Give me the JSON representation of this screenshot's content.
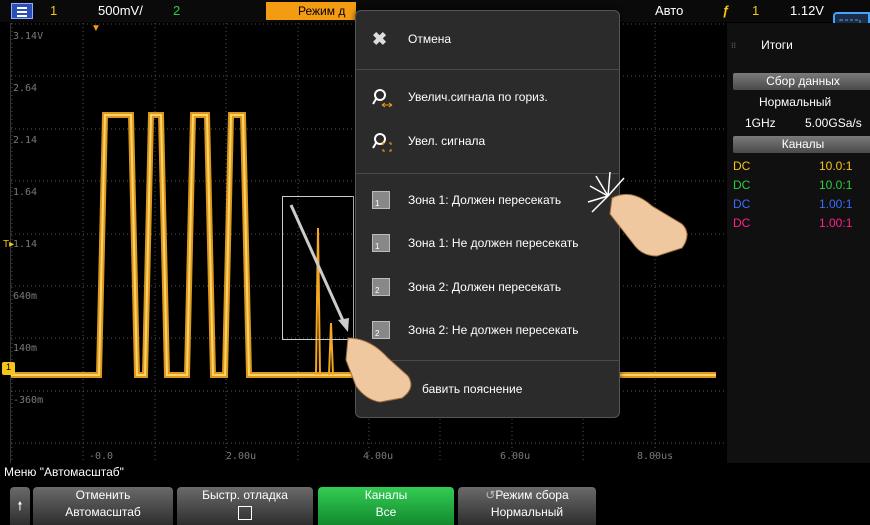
{
  "topbar": {
    "channel1": "1",
    "scale": "500mV/",
    "channel2": "2",
    "mode_tab": "Режим д",
    "trigger_mode": "Авто",
    "trigger_channel": "1",
    "trigger_level": "1.12V"
  },
  "screen": {
    "y_labels": [
      "3.14V",
      "2.64",
      "2.14",
      "1.64",
      "1.14",
      "640m",
      "140m",
      "-360m"
    ],
    "x_labels": [
      "-0.0",
      "2.00u",
      "4.00u",
      "6.00u",
      "8.00us"
    ],
    "marker_1": "1"
  },
  "popup": {
    "cancel": "Отмена",
    "zoom_horiz": "Увелич.сигнала по гориз.",
    "zoom": "Увел. сигнала",
    "zone1_must": "Зона 1: Должен пересекать",
    "zone1_must_not": "Зона 1: Не должен пересекать",
    "zone2_must": "Зона 2: Должен пересекать",
    "zone2_must_not": "Зона 2: Не должен пересекать",
    "annotate": "бавить пояснение",
    "zone1_num": "1",
    "zone2_num": "2"
  },
  "right_panel": {
    "title": "Итоги",
    "acq_header": "Сбор данных",
    "acq_mode": "Нормальный",
    "bandwidth": "1GHz",
    "sample_rate": "5.00GSa/s",
    "channels_header": "Каналы",
    "channels": [
      {
        "coupling": "DC",
        "probe": "10.0:1",
        "color": "#f5c518"
      },
      {
        "coupling": "DC",
        "probe": "10.0:1",
        "color": "#2ecc40"
      },
      {
        "coupling": "DC",
        "probe": "1.00:1",
        "color": "#3a6cff"
      },
      {
        "coupling": "DC",
        "probe": "1.00:1",
        "color": "#ff1f8f"
      }
    ]
  },
  "bottom": {
    "menu_title": "Меню \"Автомасштаб\"",
    "key1_line1": "Отменить",
    "key1_line2": "Автомасштаб",
    "key2_line1": "Быстр. отладка",
    "key3_line1": "Каналы",
    "key3_line2": "Все",
    "key4_line1": "Режим сбора",
    "key4_line2": "Нормальный"
  },
  "colors": {
    "trace": "#f5a623",
    "menu_tab": "#f39c12",
    "softkey_green": "#1fa83c"
  }
}
